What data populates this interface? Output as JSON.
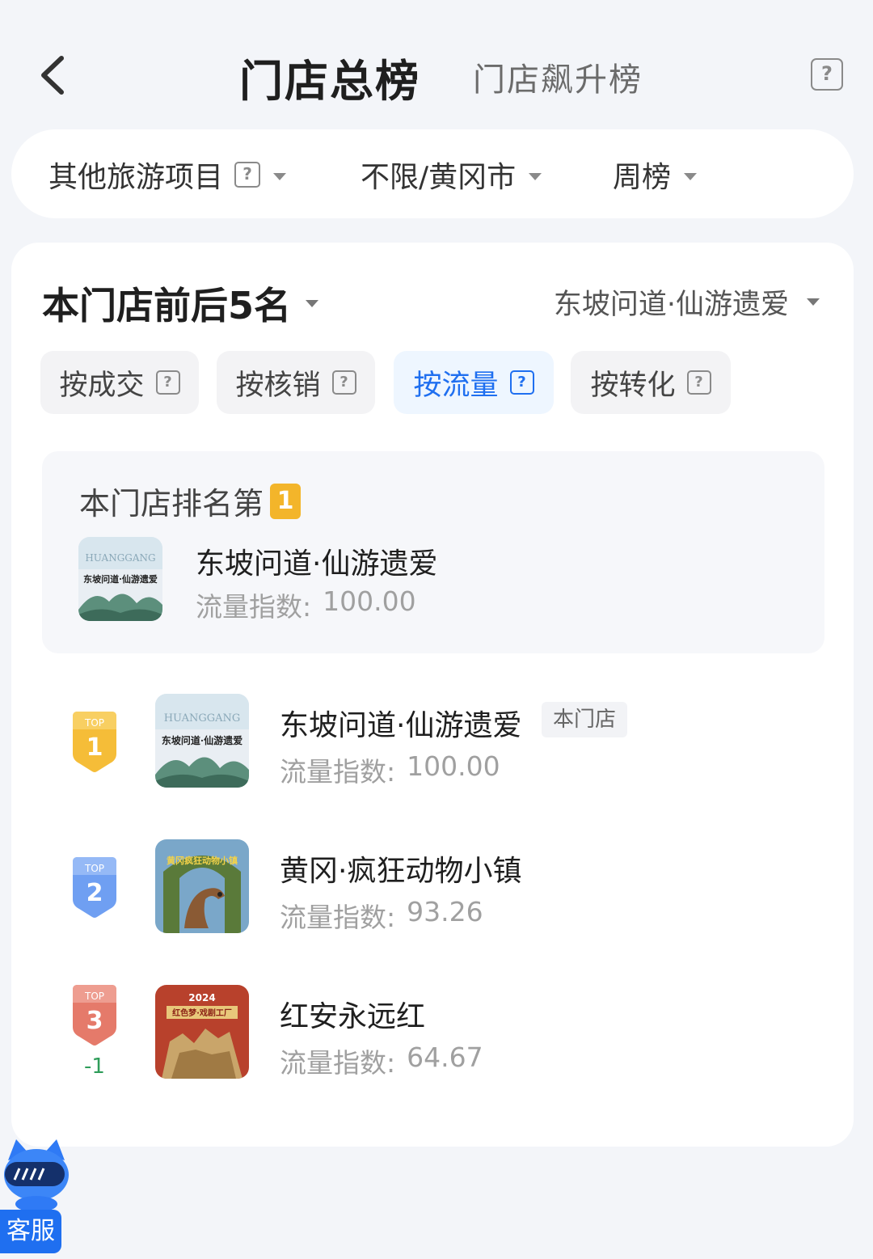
{
  "header": {
    "title": "门店总榜",
    "alt_tab": "门店飙升榜",
    "help_glyph": "?"
  },
  "filters": [
    {
      "label": "其他旅游项目",
      "has_help": true
    },
    {
      "label": "不限/黄冈市",
      "has_help": false
    },
    {
      "label": "周榜",
      "has_help": false
    }
  ],
  "card": {
    "title": "本门店前后5名",
    "store_select": "东坡问道·仙游遗爱",
    "metric_tabs": [
      {
        "label": "按成交",
        "active": false
      },
      {
        "label": "按核销",
        "active": false
      },
      {
        "label": "按流量",
        "active": true
      },
      {
        "label": "按转化",
        "active": false
      }
    ],
    "my_rank": {
      "label": "本门店排名第",
      "rank": "1",
      "store_name": "东坡问道·仙游遗爱",
      "index_label": "流量指数:",
      "index_value": "100.00",
      "thumb_text": "东坡问道·仙游遗爱",
      "thumb_sub": "HUANGGANG"
    },
    "list": [
      {
        "badge_top": "TOP",
        "badge_num": "1",
        "name": "东坡问道·仙游遗爱",
        "tag": "本门店",
        "index_label": "流量指数:",
        "index_value": "100.00",
        "change": "",
        "thumb_text": "东坡问道·仙游遗爱",
        "thumb_sub": "HUANGGANG"
      },
      {
        "badge_top": "TOP",
        "badge_num": "2",
        "name": "黄冈·疯狂动物小镇",
        "tag": "",
        "index_label": "流量指数:",
        "index_value": "93.26",
        "change": "",
        "thumb_text": "黄冈疯狂动物小镇"
      },
      {
        "badge_top": "TOP",
        "badge_num": "3",
        "name": "红安永远红",
        "tag": "",
        "index_label": "流量指数:",
        "index_value": "64.67",
        "change": "-1",
        "thumb_text": "红色梦·戏剧工厂",
        "thumb_year": "2024"
      }
    ]
  },
  "customer_service": {
    "label": "客服"
  },
  "colors": {
    "accent": "#1f6ff0",
    "gold": "#f3b52a",
    "silver": "#6f9ff2",
    "bronze": "#e57a6a",
    "down": "#2f9d5a"
  }
}
